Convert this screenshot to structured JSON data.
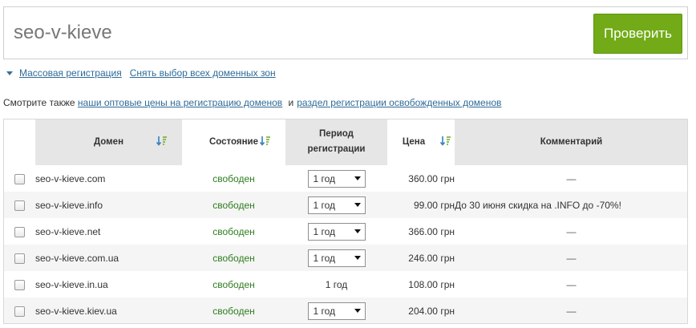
{
  "search": {
    "value": "seo-v-kieve",
    "button_label": "Проверить"
  },
  "links": {
    "bulk_registration": "Массовая регистрация",
    "deselect_all": "Снять выбор всех доменных зон"
  },
  "see_also": {
    "prefix": "Смотрите также",
    "wholesale_link": "наши оптовые цены на регистрацию доменов",
    "and": "и",
    "released_link": "раздел регистрации освобожденных доменов"
  },
  "table": {
    "headers": {
      "domain": "Домен",
      "state": "Состояние",
      "period": "Период регистрации",
      "price": "Цена",
      "comment": "Комментарий"
    },
    "rows": [
      {
        "domain": "seo-v-kieve.com",
        "state": "свободен",
        "period": "1 год",
        "period_select": true,
        "price": "360.00 грн",
        "comment": "—"
      },
      {
        "domain": "seo-v-kieve.info",
        "state": "свободен",
        "period": "1 год",
        "period_select": true,
        "price": "99.00 грн",
        "comment": "До 30 июня скидка на .INFO до -70%!"
      },
      {
        "domain": "seo-v-kieve.net",
        "state": "свободен",
        "period": "1 год",
        "period_select": true,
        "price": "366.00 грн",
        "comment": "—"
      },
      {
        "domain": "seo-v-kieve.com.ua",
        "state": "свободен",
        "period": "1 год",
        "period_select": true,
        "price": "246.00 грн",
        "comment": "—"
      },
      {
        "domain": "seo-v-kieve.in.ua",
        "state": "свободен",
        "period": "1 год",
        "period_select": false,
        "price": "108.00 грн",
        "comment": "—"
      },
      {
        "domain": "seo-v-kieve.kiev.ua",
        "state": "свободен",
        "period": "1 год",
        "period_select": true,
        "price": "204.00 грн",
        "comment": "—"
      }
    ]
  },
  "icons": {
    "sort": "sort-icon",
    "bulk_toggle": "triangle-down-icon",
    "select_arrow": "chevron-down-icon"
  },
  "colors": {
    "accent_button": "#72ab17",
    "link": "#2f6b98",
    "status_free": "#2e7d1e",
    "header_shaded": "#e6e6e6"
  }
}
